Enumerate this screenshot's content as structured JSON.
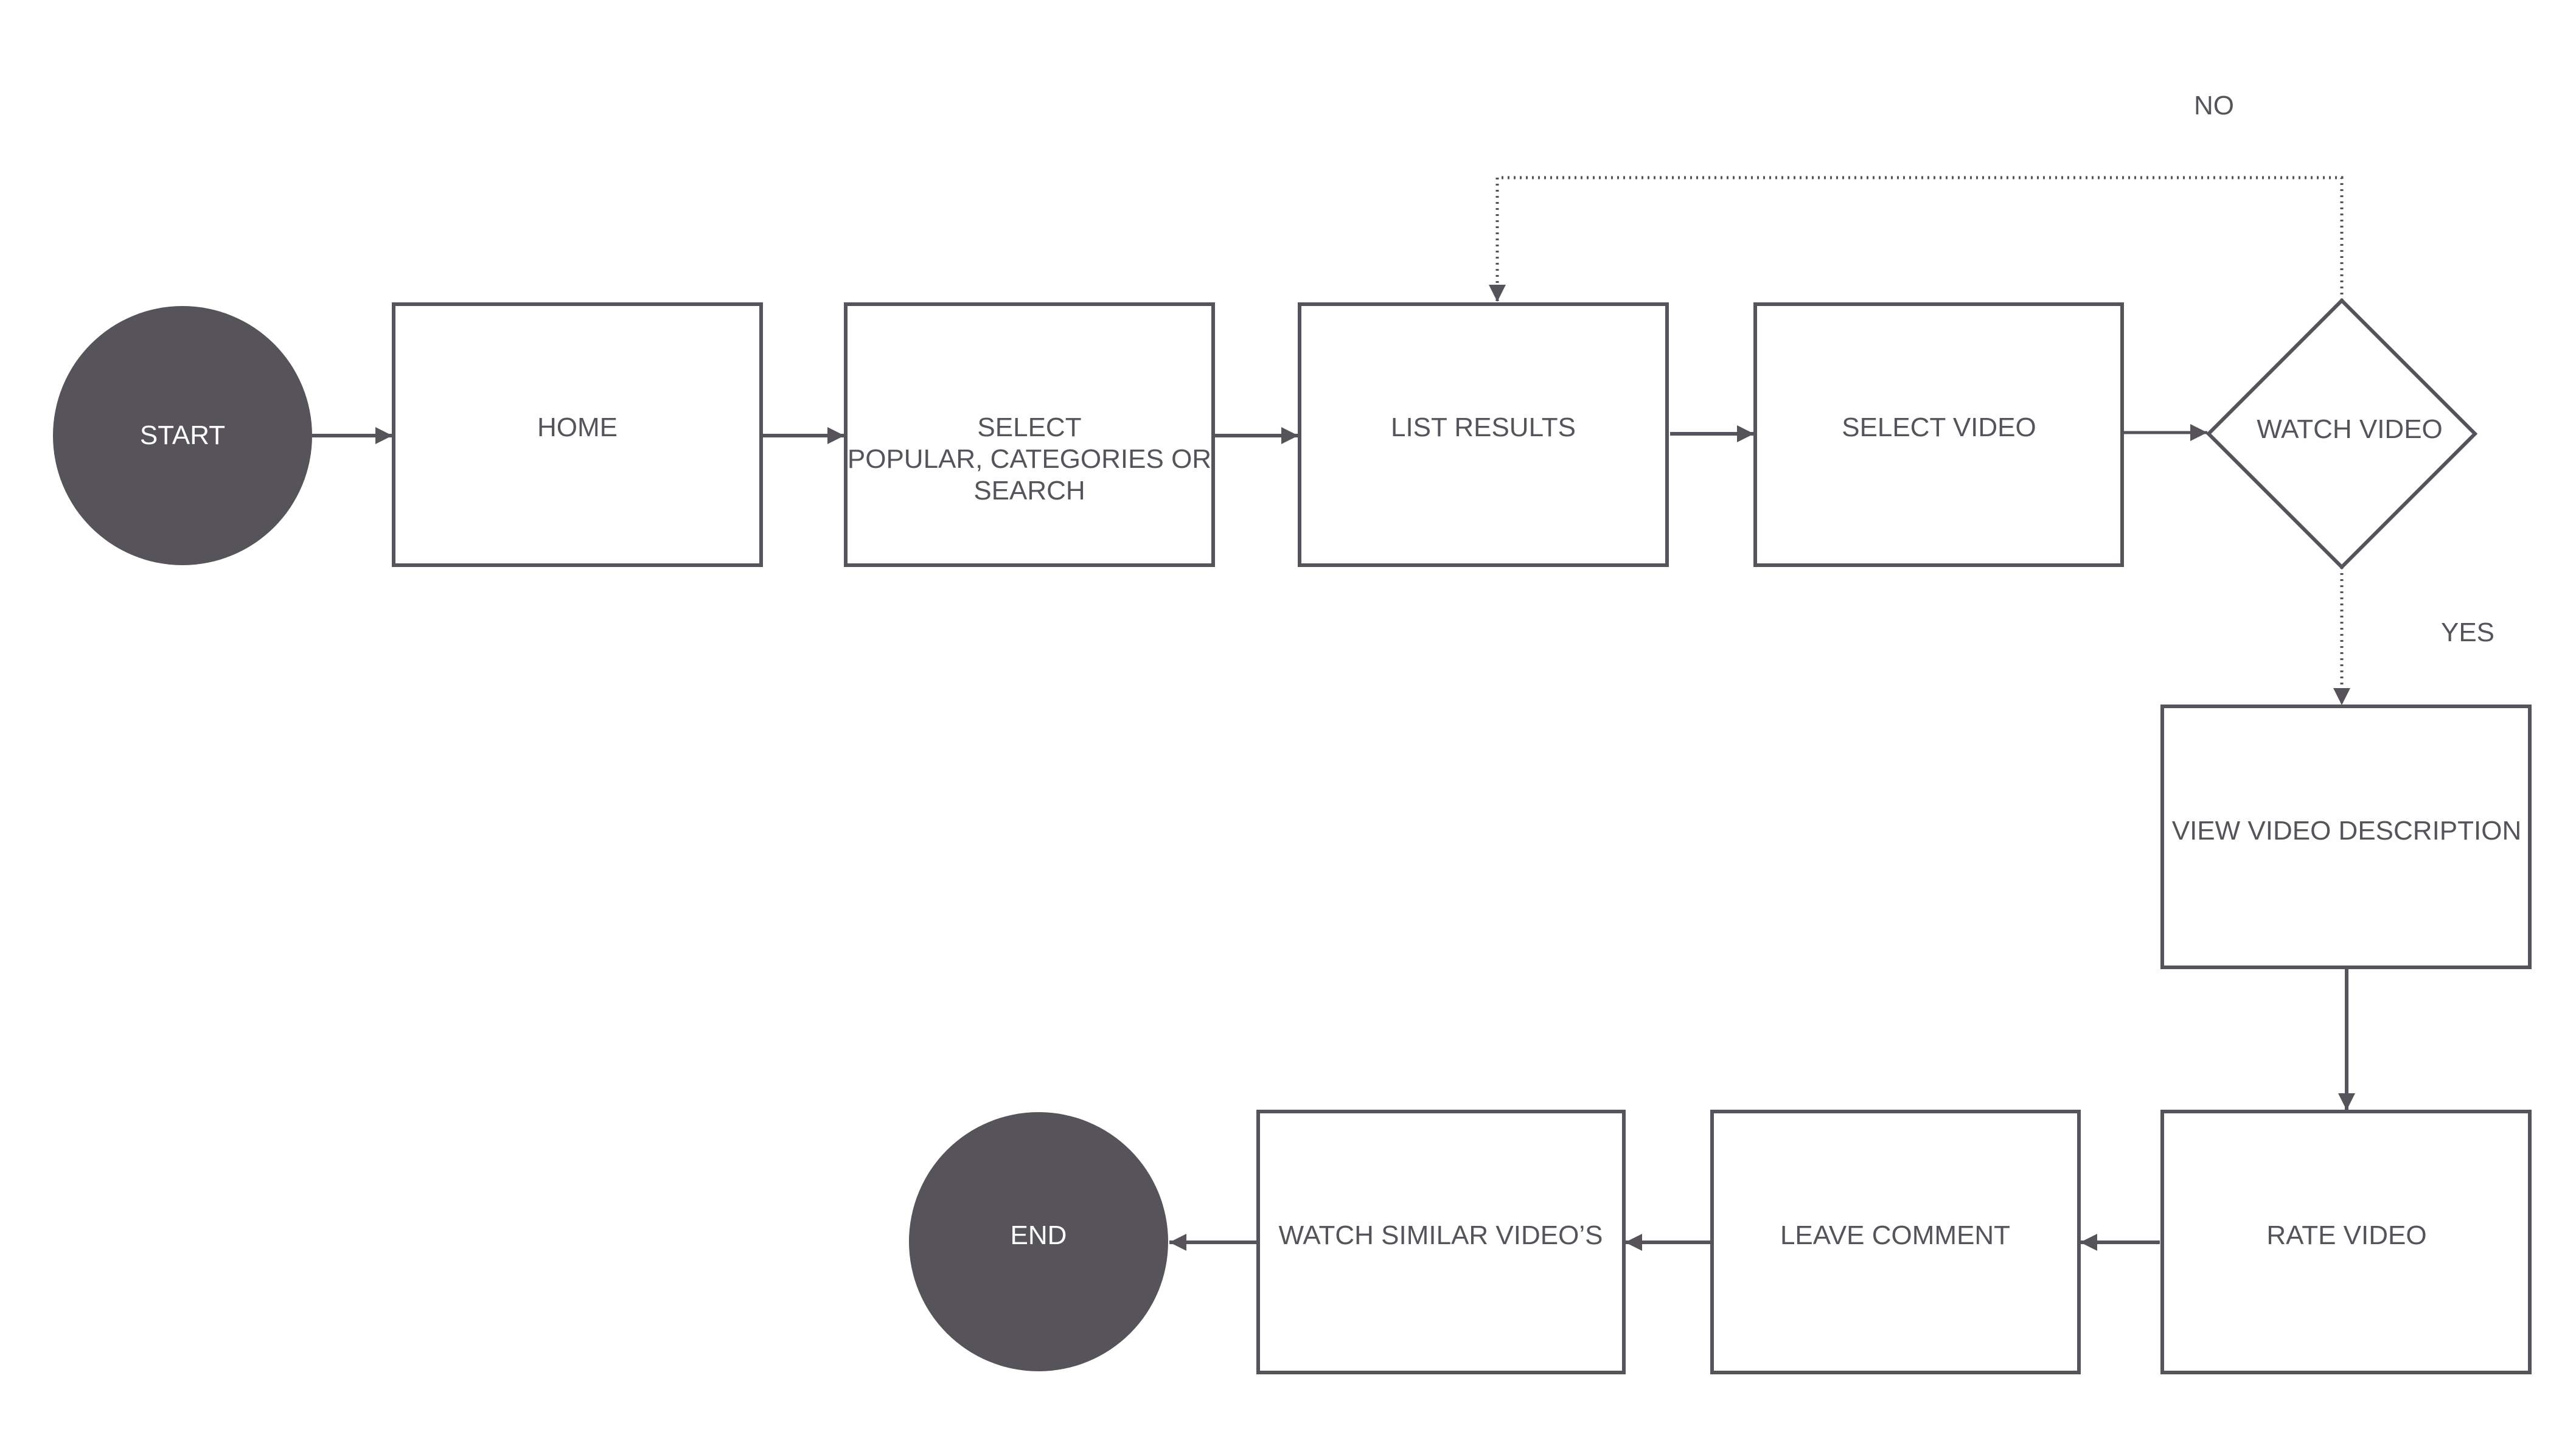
{
  "diagram": {
    "type": "flowchart",
    "colors": {
      "stroke": "#57535b",
      "terminal_fill": "#57535b",
      "terminal_text": "#ffffff",
      "text": "#57535b",
      "background": "#ffffff"
    },
    "nodes": {
      "start": {
        "label": "START",
        "shape": "circle"
      },
      "home": {
        "label": "HOME",
        "shape": "rect"
      },
      "select": {
        "lines": [
          "SELECT",
          "POPULAR, CATEGORIES OR",
          "SEARCH"
        ],
        "shape": "rect"
      },
      "list_results": {
        "label": "LIST RESULTS",
        "shape": "rect"
      },
      "select_video": {
        "label": "SELECT VIDEO",
        "shape": "rect"
      },
      "watch_video": {
        "label": "WATCH VIDEO",
        "shape": "diamond"
      },
      "view_description": {
        "label": "VIEW VIDEO DESCRIPTION",
        "shape": "rect"
      },
      "rate_video": {
        "label": "RATE VIDEO",
        "shape": "rect"
      },
      "leave_comment": {
        "label": "LEAVE COMMENT",
        "shape": "rect"
      },
      "watch_similar": {
        "label": "WATCH SIMILAR VIDEO’S",
        "shape": "rect"
      },
      "end": {
        "label": "END",
        "shape": "circle"
      }
    },
    "edges": [
      {
        "from": "start",
        "to": "home",
        "style": "solid"
      },
      {
        "from": "home",
        "to": "select",
        "style": "solid"
      },
      {
        "from": "select",
        "to": "list_results",
        "style": "solid"
      },
      {
        "from": "list_results",
        "to": "select_video",
        "style": "solid"
      },
      {
        "from": "select_video",
        "to": "watch_video",
        "style": "solid"
      },
      {
        "from": "watch_video",
        "to": "list_results",
        "style": "dotted",
        "label": "NO"
      },
      {
        "from": "watch_video",
        "to": "view_description",
        "style": "dotted",
        "label": "YES"
      },
      {
        "from": "view_description",
        "to": "rate_video",
        "style": "solid"
      },
      {
        "from": "rate_video",
        "to": "leave_comment",
        "style": "solid"
      },
      {
        "from": "leave_comment",
        "to": "watch_similar",
        "style": "solid"
      },
      {
        "from": "watch_similar",
        "to": "end",
        "style": "solid"
      }
    ],
    "edge_labels": {
      "no": "NO",
      "yes": "YES"
    }
  }
}
